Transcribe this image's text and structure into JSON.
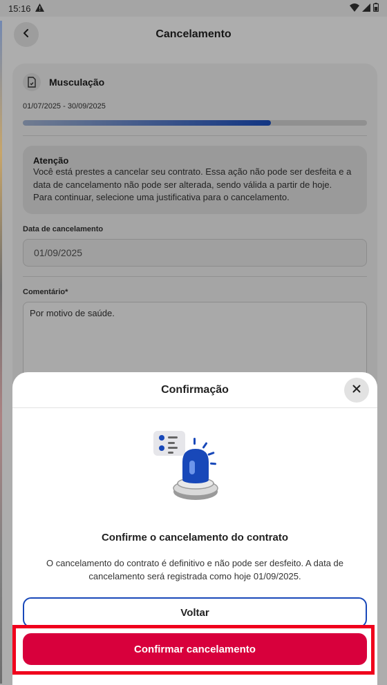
{
  "status_bar": {
    "time": "15:16"
  },
  "header": {
    "title": "Cancelamento"
  },
  "plan": {
    "name": "Musculação",
    "dates": "01/07/2025 - 30/09/2025",
    "progress": 0.72
  },
  "alert": {
    "title": "Atenção",
    "text": "Você está prestes a cancelar seu contrato. Essa ação não pode ser desfeita e a data de cancelamento não pode ser alterada, sendo válida a partir de hoje.\nPara continuar, selecione uma justificativa para o cancelamento."
  },
  "form": {
    "date_label": "Data de cancelamento",
    "date_value": "01/09/2025",
    "comment_label": "Comentário*",
    "comment_value": "Por motivo de saúde."
  },
  "sheet": {
    "title": "Confirmação",
    "heading": "Confirme o cancelamento do contrato",
    "text": "O cancelamento do contrato é definitivo e não pode ser desfeito. A data de cancelamento será registrada como hoje 01/09/2025.",
    "back_label": "Voltar",
    "confirm_label": "Confirmar cancelamento"
  },
  "colors": {
    "accent_blue": "#1848b9",
    "danger_red": "#d8003c",
    "highlight": "#f0001c"
  }
}
